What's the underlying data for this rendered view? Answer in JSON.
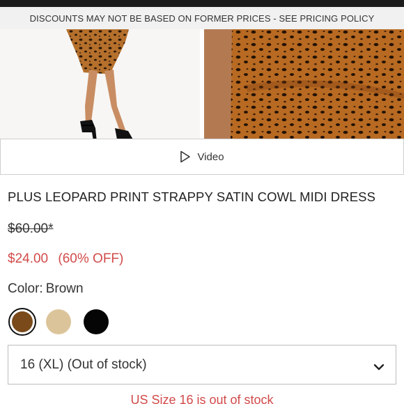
{
  "promo_banner": "DISCOUNTS MAY NOT BE BASED ON FORMER PRICES - SEE PRICING POLICY",
  "gallery": {
    "images": [
      {
        "alt": "",
        "icon": "product-photo"
      },
      {
        "alt": "",
        "icon": "product-photo"
      }
    ]
  },
  "video_button": {
    "label": "Video",
    "icon": "play-icon"
  },
  "product": {
    "title": "PLUS LEOPARD PRINT STRAPPY SATIN COWL MIDI DRESS",
    "original_price": "$60.00*",
    "sale_price": "$24.00",
    "discount": "(60% OFF)"
  },
  "color": {
    "label": "Color:",
    "selected": "Brown",
    "swatches": [
      {
        "name": "Brown",
        "hex": "#7a4a1a",
        "selected": true
      },
      {
        "name": "Beige",
        "hex": "#dcc49a",
        "selected": false
      },
      {
        "name": "Black",
        "hex": "#050505",
        "selected": false
      }
    ]
  },
  "size_select": {
    "value": "16 (XL) (Out of stock)",
    "icon": "chevron-down-icon"
  },
  "stock_message": "US Size 16 is out of stock",
  "colors": {
    "sale_red": "#d24a4a",
    "text": "#222222",
    "banner_bg": "#f1f1f1"
  }
}
